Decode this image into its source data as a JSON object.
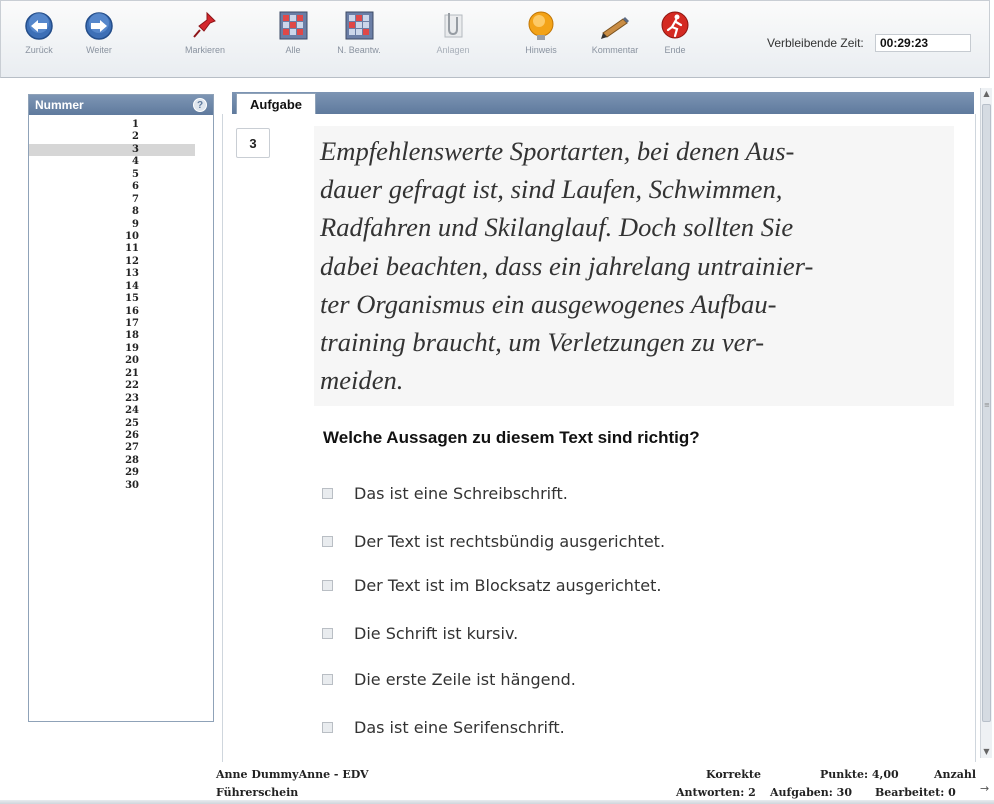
{
  "toolbar": {
    "buttons": [
      {
        "id": "back",
        "label": "Zurück",
        "icon": "back-arrow-icon"
      },
      {
        "id": "forward",
        "label": "Weiter",
        "icon": "forward-arrow-icon"
      },
      {
        "id": "mark",
        "label": "Markieren",
        "icon": "pin-icon"
      },
      {
        "id": "all",
        "label": "Alle",
        "icon": "grid-all-icon"
      },
      {
        "id": "unanswered",
        "label": "N. Beantw.",
        "icon": "grid-unanswered-icon"
      },
      {
        "id": "attachments",
        "label": "Anlagen",
        "icon": "paperclip-icon"
      },
      {
        "id": "hint",
        "label": "Hinweis",
        "icon": "lightbulb-icon"
      },
      {
        "id": "comment",
        "label": "Kommentar",
        "icon": "pencil-icon"
      },
      {
        "id": "end",
        "label": "Ende",
        "icon": "exit-runner-icon"
      }
    ],
    "timer_label": "Verbleibende Zeit:",
    "timer_value": "00:29:23"
  },
  "sidebar": {
    "header": "Nummer",
    "help_icon": "help-icon",
    "numbers": [
      "1",
      "2",
      "3",
      "4",
      "5",
      "6",
      "7",
      "8",
      "9",
      "10",
      "11",
      "12",
      "13",
      "14",
      "15",
      "16",
      "17",
      "18",
      "19",
      "20",
      "21",
      "22",
      "23",
      "24",
      "25",
      "26",
      "27",
      "28",
      "29",
      "30"
    ],
    "selected": "3"
  },
  "tab": {
    "label": "Aufgabe"
  },
  "question": {
    "number": "3",
    "passage_lines": [
      "Empfehlenswerte Sportarten, bei denen Aus-",
      "dauer gefragt ist, sind Laufen, Schwimmen,",
      "Radfahren und Skilanglauf. Doch sollten Sie",
      "dabei beachten, dass ein jahrelang untrainier-",
      "ter Organismus ein ausgewogenes Aufbau-",
      "training braucht, um Verletzungen zu ver-",
      "meiden."
    ],
    "prompt": "Welche Aussagen zu diesem Text sind richtig?",
    "options": [
      {
        "label": "Das ist eine Schreibschrift.",
        "checked": false
      },
      {
        "label": "Der Text ist rechtsbündig ausgerichtet.",
        "checked": false
      },
      {
        "label": "Der Text ist im Blocksatz ausgerichtet.",
        "checked": false
      },
      {
        "label": "Die Schrift ist kursiv.",
        "checked": false
      },
      {
        "label": "Die erste Zeile ist hängend.",
        "checked": false
      },
      {
        "label": "Das ist eine Serifenschrift.",
        "checked": false
      }
    ]
  },
  "status": {
    "user": "Anne DummyAnne - EDV",
    "exam": "Führerschein",
    "correct_label": "Korrekte",
    "answers": "Antworten: 2",
    "points": "Punkte: 4,00",
    "tasks": "Aufgaben: 30",
    "count_label": "Anzahl",
    "edited": "Bearbeitet: 0"
  },
  "colors": {
    "accent": "#6a84a6",
    "toolbar_bg": "#eef1f4",
    "selected_row": "#d6d6d6",
    "passage_bg": "#f6f6f6"
  }
}
